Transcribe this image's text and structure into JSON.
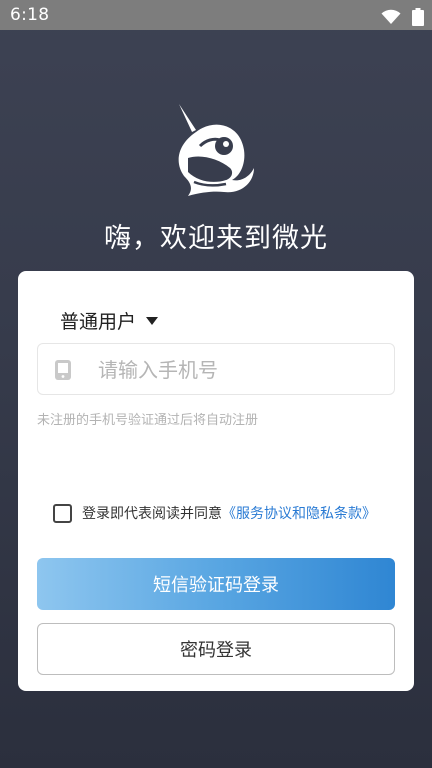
{
  "status_bar": {
    "time": "6:18"
  },
  "app": {
    "welcome_title": "嗨，欢迎来到微光"
  },
  "login_form": {
    "user_type_label": "普通用户",
    "phone_placeholder": "请输入手机号",
    "phone_value": "",
    "hint": "未注册的手机号验证通过后将自动注册",
    "agreement_text": "登录即代表阅读并同意",
    "agreement_link": "《服务协议和隐私条款》",
    "agreement_checked": false,
    "sms_login_label": "短信验证码登录",
    "password_login_label": "密码登录"
  },
  "icons": {
    "logo": "narwhal-logo",
    "wifi": "wifi-icon",
    "battery": "battery-icon",
    "phone": "mobile-phone-icon",
    "dropdown": "caret-down-icon"
  },
  "colors": {
    "background": "#383d4d",
    "link": "#2a7bd4",
    "sms_button_start": "#8ec6ef",
    "sms_button_end": "#2f86d3"
  }
}
